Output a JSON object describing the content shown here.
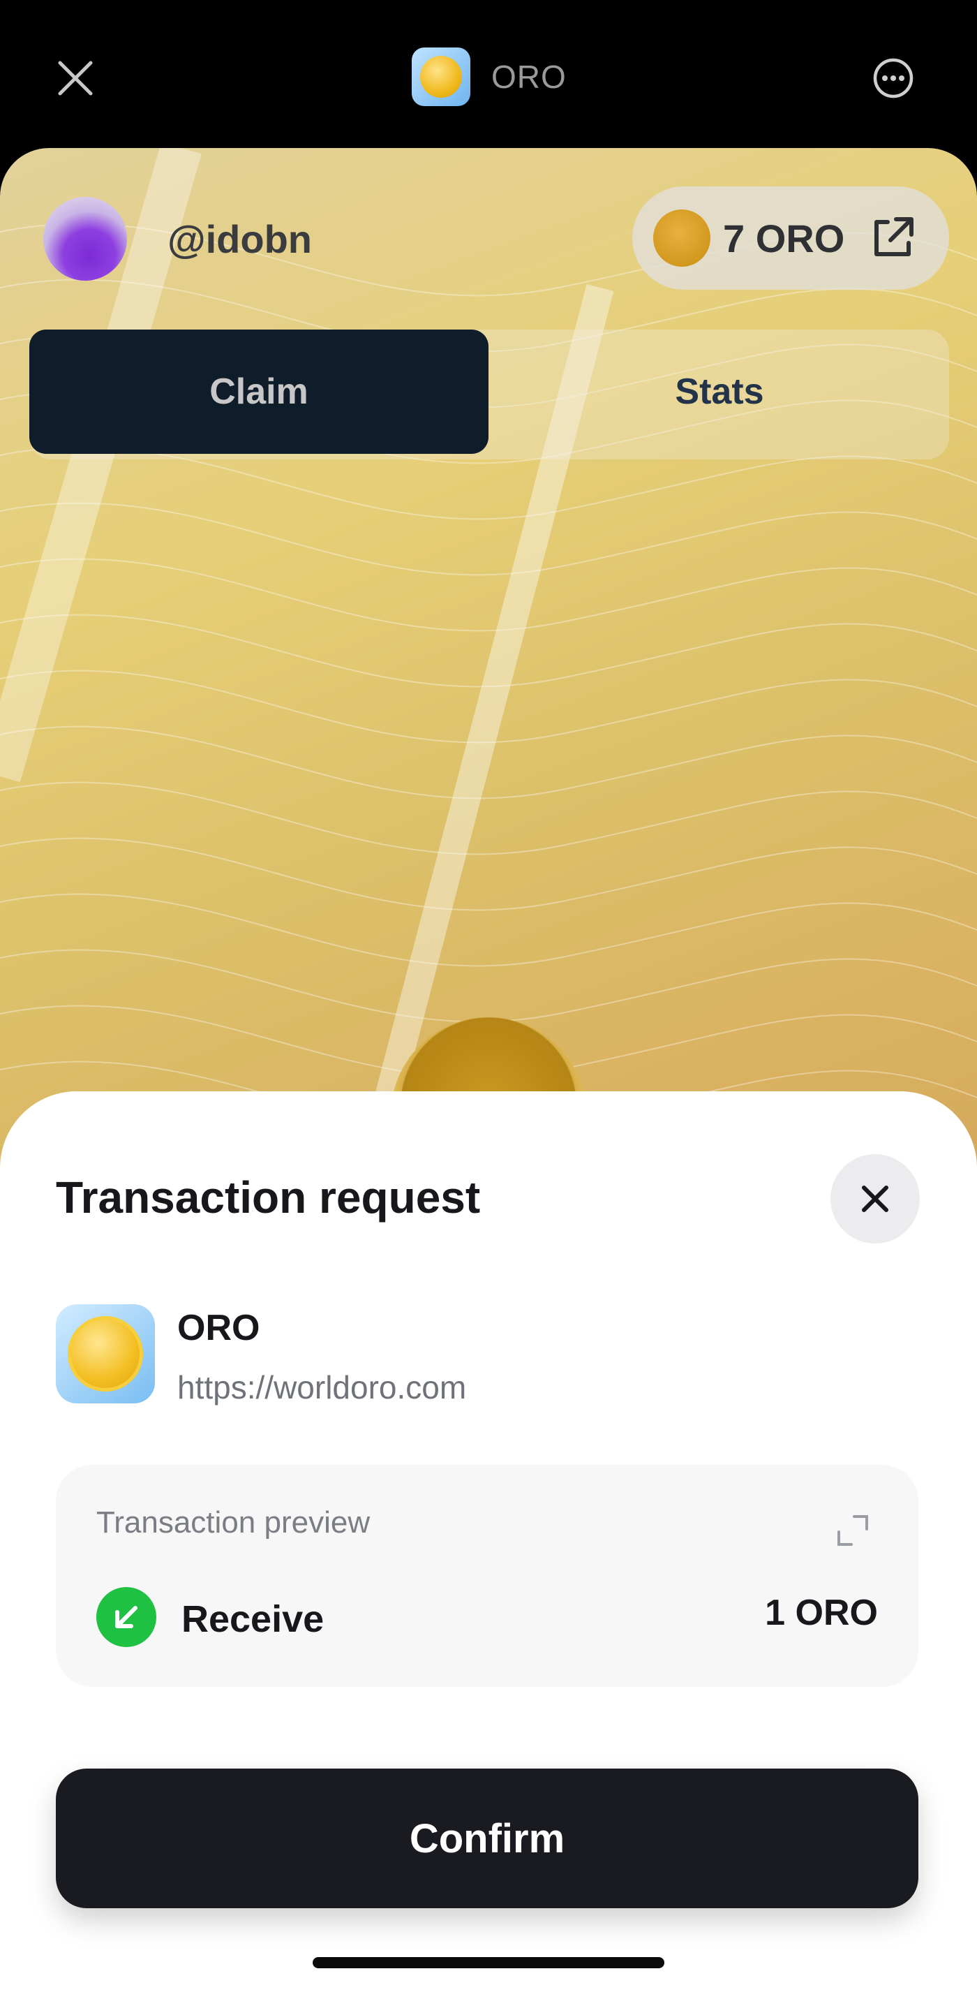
{
  "topbar": {
    "title": "ORO"
  },
  "mini_app": {
    "username": "@idobn",
    "balance": "7 ORO",
    "tabs": [
      {
        "label": "Claim",
        "active": true
      },
      {
        "label": "Stats",
        "active": false
      }
    ]
  },
  "sheet": {
    "title": "Transaction request",
    "app": {
      "name": "ORO",
      "url": "https://worldoro.com"
    },
    "preview": {
      "label": "Transaction preview",
      "action": "Receive",
      "amount": "1 ORO"
    },
    "confirm_label": "Confirm"
  },
  "colors": {
    "confirm_bg": "#191b20",
    "receive_green": "#1ec142",
    "tab_active_bg": "#0f1c2a"
  },
  "icons": [
    "close-icon",
    "more-icon",
    "external-link-icon",
    "expand-icon",
    "arrow-down-left-icon"
  ]
}
